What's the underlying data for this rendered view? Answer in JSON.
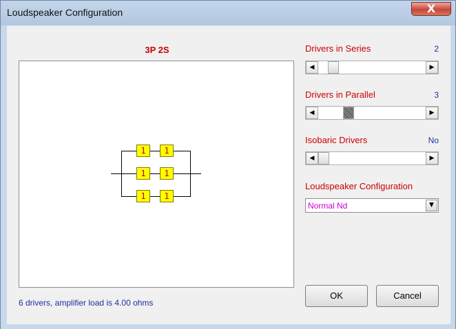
{
  "window": {
    "title": "Loudspeaker Configuration",
    "close_glyph": "X"
  },
  "diagram": {
    "config_label": "3P 2S",
    "driver_label": "1",
    "status": "6 drivers, amplifier load is 4.00 ohms",
    "series_count": 2,
    "parallel_count": 3
  },
  "controls": {
    "series": {
      "label": "Drivers in Series",
      "value": "2",
      "level": 0.1
    },
    "parallel": {
      "label": "Drivers in Parallel",
      "value": "3",
      "level": 0.25
    },
    "isobaric": {
      "label": "Isobaric Drivers",
      "value": "No",
      "level": 0.0
    },
    "configuration": {
      "label": "Loudspeaker Configuration",
      "selected": "Normal Nd"
    }
  },
  "buttons": {
    "ok": "OK",
    "cancel": "Cancel"
  },
  "icons": {
    "scroll_left": "left-arrow-icon",
    "scroll_right": "right-arrow-icon",
    "dropdown": "chevron-down-icon"
  },
  "colors": {
    "label_red": "#cc0000",
    "value_blue": "#1f2fa0",
    "driver_fill": "#ffff00",
    "select_text": "#cc00cc"
  }
}
